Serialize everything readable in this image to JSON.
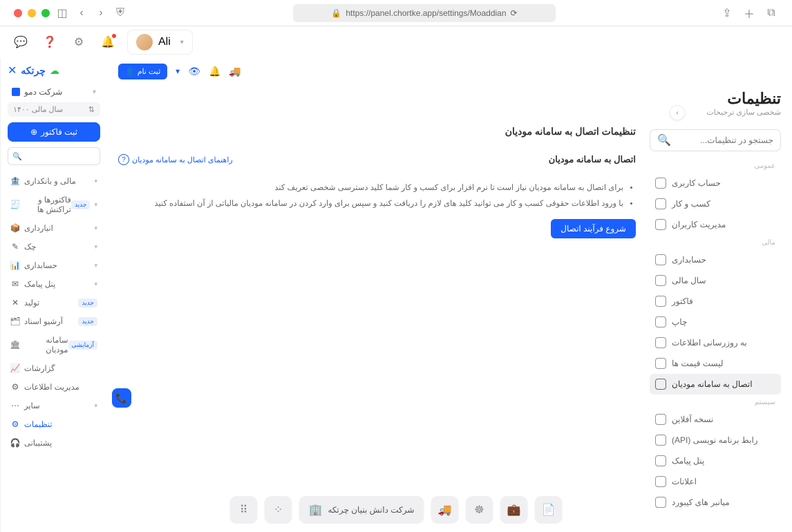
{
  "url": "https://panel.chortke.app/settings/Moaddian",
  "user": {
    "name": "Ali"
  },
  "brand": "چرتکه",
  "company": "شرکت دمو",
  "fiscal_year": "سال مالی ۱۴۰۰",
  "create_invoice": "ثبت فاکتور",
  "sidebar_search_placeholder": "",
  "nav": [
    {
      "label": "مالی و بانکداری",
      "icon": "🏦",
      "chev": true
    },
    {
      "label": "فاکتورها و تراکنش ها",
      "icon": "🧾",
      "chev": true,
      "badge": "جدید"
    },
    {
      "label": "انبارداری",
      "icon": "📦",
      "chev": true
    },
    {
      "label": "چک",
      "icon": "✎",
      "chev": true
    },
    {
      "label": "حسابداری",
      "icon": "📊",
      "chev": true
    },
    {
      "label": "پنل پیامک",
      "icon": "✉",
      "chev": true
    },
    {
      "label": "تولید",
      "icon": "✕",
      "badge": "جدید"
    },
    {
      "label": "آرشیو اسناد",
      "icon": "🗂",
      "badge": "جدید"
    },
    {
      "label": "سامانه مودیان",
      "icon": "🏛",
      "badge": "آزمایشی"
    },
    {
      "label": "گزارشات",
      "icon": "📈"
    },
    {
      "label": "مدیریت اطلاعات",
      "icon": "⚙"
    },
    {
      "label": "سایر",
      "icon": "⋯",
      "chev": true
    },
    {
      "label": "تنظیمات",
      "icon": "⚙",
      "active": true
    },
    {
      "label": "پشتیبانی",
      "icon": "🎧"
    }
  ],
  "action_bar": {
    "register": "ثبت نام"
  },
  "page": {
    "title": "تنظیمات",
    "subtitle": "شخصی سازی ترجیحات"
  },
  "settings_search_placeholder": "جستجو در تنظیمات...",
  "groups": {
    "general": "عمومی",
    "financial": "مالی",
    "system": "سیستم"
  },
  "snav_general": [
    {
      "label": "حساب کاربری"
    },
    {
      "label": "کسب و کار"
    },
    {
      "label": "مدیریت کاربران"
    }
  ],
  "snav_financial": [
    {
      "label": "حسابداری"
    },
    {
      "label": "سال مالی"
    },
    {
      "label": "فاکتور"
    },
    {
      "label": "چاپ"
    },
    {
      "label": "به روزرسانی اطلاعات"
    },
    {
      "label": "لیست قیمت ها"
    },
    {
      "label": "اتصال به سامانه مودیان",
      "active": true
    }
  ],
  "snav_system": [
    {
      "label": "نسخه آفلاین"
    },
    {
      "label": "رابط برنامه نویسی (API)"
    },
    {
      "label": "پنل پیامک"
    },
    {
      "label": "اعلانات"
    },
    {
      "label": "میانبر های کیبورد"
    }
  ],
  "detail": {
    "heading": "تنظیمات اتصال به سامانه مودیان",
    "sub": "اتصال به سامانه مودیان",
    "help": "راهنمای اتصال به سامانه مودیان",
    "bullet1": "برای اتصال به سامانه مودیان نیاز است تا نرم افزار برای کسب و کار شما کلید دسترسی شخصی تعریف کند",
    "bullet2": "با ورود اطلاعات حقوقی کسب و کار می توانید کلید های لازم را دریافت کنید و سپس برای وارد کردن در سامانه مودیان مالیاتی از آن استفاده کنید",
    "button": "شروع فرآیند اتصال"
  },
  "dock_company": "شرکت دانش بنیان چرتکه"
}
